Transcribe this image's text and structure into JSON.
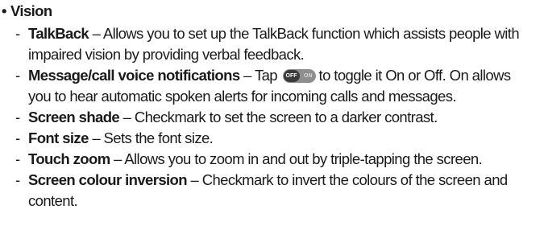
{
  "heading": {
    "bullet": "•",
    "title": "Vision"
  },
  "items": [
    {
      "dash": "-",
      "term": "TalkBack",
      "text": " – Allows you to set up the TalkBack function which assists people with",
      "cont": "impaired vision by providing verbal feedback."
    },
    {
      "dash": "-",
      "term": "Message/call voice notifications",
      "text_before": " – Tap",
      "toggle": {
        "off_label": "OFF",
        "on_label": "ON",
        "icon": "off-on-toggle-icon"
      },
      "text_after": "to toggle it On or Off. On allows",
      "cont": "you to hear automatic spoken alerts for incoming calls and messages."
    },
    {
      "dash": "-",
      "term": "Screen shade",
      "text": " – Checkmark to set the screen to a darker contrast."
    },
    {
      "dash": "-",
      "term": "Font size",
      "text": " – Sets the font size."
    },
    {
      "dash": "-",
      "term": "Touch zoom",
      "text": " – Allows you to zoom in and out by triple-tapping the screen."
    },
    {
      "dash": "-",
      "term": "Screen colour inversion",
      "text": " – Checkmark to invert the colours of the screen and",
      "cont": "content."
    }
  ]
}
